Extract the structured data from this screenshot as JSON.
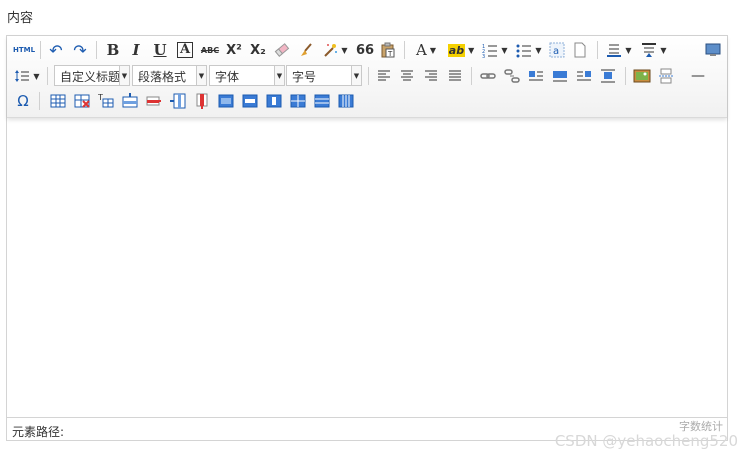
{
  "field": {
    "label": "内容"
  },
  "toolbar": {
    "html_label": "HTML",
    "undo_icon": "↶",
    "redo_icon": "↷",
    "bold_label": "B",
    "italic_label": "I",
    "underline_label": "U",
    "fontborder_label": "A",
    "strike_label": "ABC",
    "superscript_label": "X²",
    "subscript_label": "X₂",
    "blockquote_label": "66",
    "forecolor_label": "A",
    "backcolor_label": "ab",
    "customstyle_value": "自定义标题",
    "paragraph_value": "段落格式",
    "fontfamily_value": "字体",
    "fontsize_value": "字号",
    "special_char_label": "Ω",
    "horizontal_label": "—"
  },
  "statusbar": {
    "path_label": "元素路径:",
    "wordcount_label": "字数统计"
  },
  "watermark": "CSDN @yehaocheng520",
  "colors": {
    "accent": "#1c5bb0",
    "toolbar_border": "#dadada"
  }
}
